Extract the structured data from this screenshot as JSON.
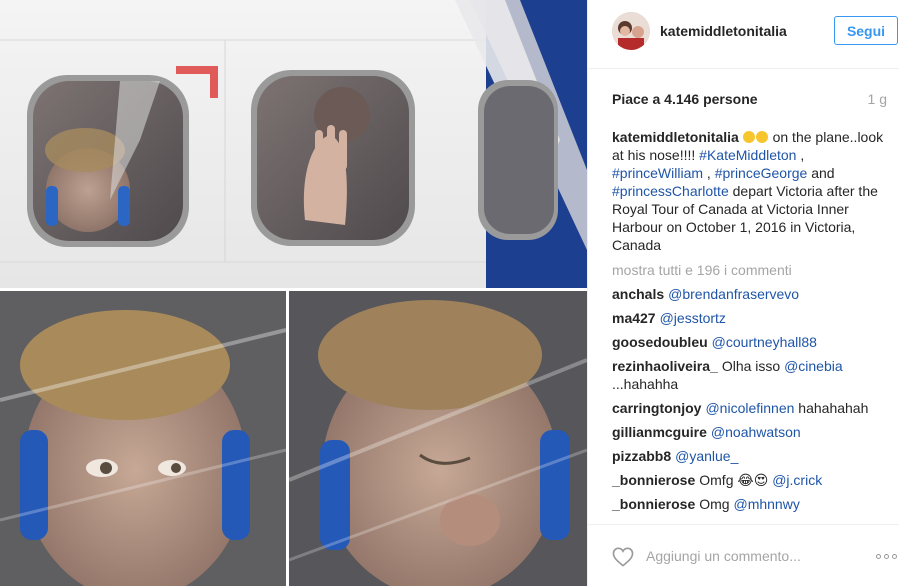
{
  "post": {
    "author": "katemiddletonitalia",
    "follow_label": "Segui",
    "likes_text": "Piace a 4.146 persone",
    "age": "1 g",
    "caption": {
      "username": "katemiddletonitalia",
      "text_1": " on the plane..look at his nose!!!! ",
      "tag_1": "#KateMiddleton",
      "text_2": " , ",
      "tag_2": "#princeWilliam",
      "text_3": " , ",
      "tag_3": "#princeGeorge",
      "text_4": " and ",
      "tag_4": "#princessCharlotte",
      "text_5": " depart Victoria after the Royal Tour of Canada at Victoria Inner Harbour on October 1, 2016 in Victoria, Canada"
    },
    "show_all_comments": "mostra tutti e 196 i commenti"
  },
  "comments": [
    {
      "user": "anchals",
      "text": "",
      "mention": "@brendanfraservevo"
    },
    {
      "user": "ma427",
      "text": "",
      "mention": "@jesstortz"
    },
    {
      "user": "goosedoubleu",
      "text": "",
      "mention": "@courtneyhall88"
    },
    {
      "user": "rezinhaoliveira_",
      "text": "Olha isso ",
      "mention": "@cinebia",
      "after": "...hahahha"
    },
    {
      "user": "carringtonjoy",
      "text": "",
      "mention": "@nicolefinnen",
      "after_inline": " hahahahah"
    },
    {
      "user": "gillianmcguire",
      "text": "",
      "mention": "@noahwatson"
    },
    {
      "user": "pizzabb8",
      "text": "",
      "mention": "@yanlue_"
    },
    {
      "user": "_bonnierose",
      "text": "Omfg ",
      "emoji": "😂😍",
      "mention": "@j.crick"
    },
    {
      "user": "_bonnierose",
      "text": "Omg ",
      "mention": "@mhnnwy"
    }
  ],
  "footer": {
    "comment_placeholder": "Aggiungi un commento...",
    "like_icon": "heart-outline-icon",
    "more_icon": "more-options-icon"
  },
  "colors": {
    "link": "#1f55a8",
    "follow": "#3897f0",
    "muted": "#a5a5a5"
  }
}
